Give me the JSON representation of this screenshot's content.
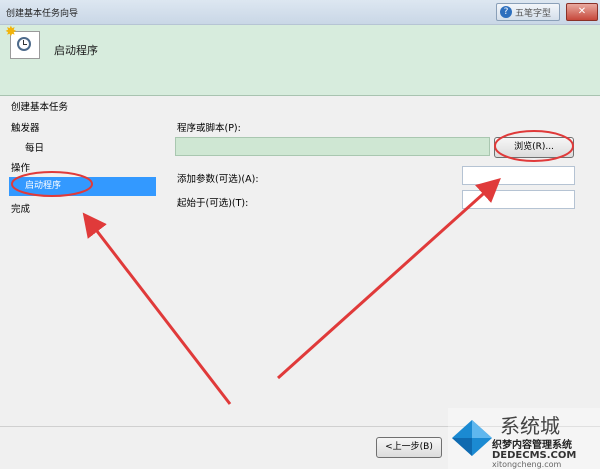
{
  "window": {
    "title": "创建基本任务向导",
    "help_watermark": "五笔字型",
    "close_label": "✕"
  },
  "header": {
    "title": "启动程序"
  },
  "sidebar": {
    "items": [
      {
        "label": "创建基本任务"
      },
      {
        "label": "触发器"
      },
      {
        "label": "每日"
      },
      {
        "label": "操作"
      },
      {
        "label": "启动程序"
      },
      {
        "label": "完成"
      }
    ]
  },
  "form": {
    "program_label": "程序或脚本(P):",
    "program_value": "",
    "browse_label": "浏览(R)...",
    "args_label": "添加参数(可选)(A):",
    "args_value": "",
    "start_in_label": "起始于(可选)(T):",
    "start_in_value": ""
  },
  "footer": {
    "back_label": "<上一步(B)"
  },
  "watermark": {
    "brand": "系统城",
    "line1": "织梦内容管理系统",
    "line2": "DEDECMS.COM",
    "line3": "xitongcheng.com"
  },
  "annotations": {
    "color": "#e03a3a"
  }
}
